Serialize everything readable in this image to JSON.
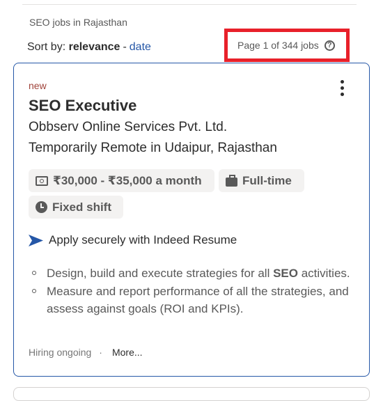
{
  "heading": "SEO jobs in Rajasthan",
  "sort": {
    "label": "Sort by:",
    "active": "relevance",
    "separator": "-",
    "alt": "date"
  },
  "pagination": {
    "text": "Page 1 of 344 jobs",
    "help_icon": "question-circle-icon"
  },
  "colors": {
    "accent": "#2557a7",
    "highlight_border": "#e8202a",
    "badge": "#a0443b"
  },
  "job": {
    "badge": "new",
    "title": "SEO Executive",
    "company": "Obbserv Online Services Pvt. Ltd.",
    "location": "Temporarily Remote in Udaipur, Rajasthan",
    "chips": {
      "salary": "₹30,000 - ₹35,000 a month",
      "job_type": "Full-time",
      "shift": "Fixed shift"
    },
    "apply_text": "Apply securely with Indeed Resume",
    "bullets": [
      {
        "before": "Design, build and execute strategies for all ",
        "bold": "SEO",
        "after": " activities."
      },
      {
        "before": "Measure and report performance of all the strategies, and assess against goals (ROI and KPIs).",
        "bold": "",
        "after": ""
      }
    ],
    "footer": {
      "hiring": "Hiring ongoing",
      "dot": "·",
      "more": "More..."
    }
  }
}
